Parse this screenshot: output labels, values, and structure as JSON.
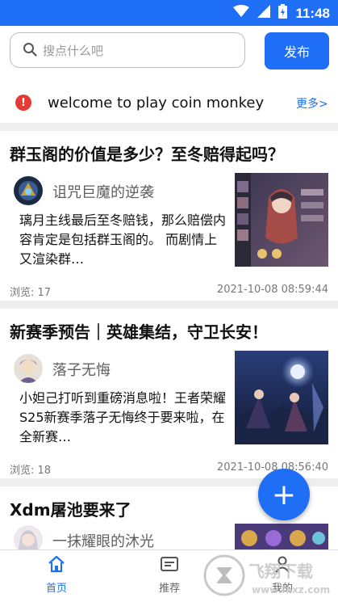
{
  "status": {
    "time": "11:48"
  },
  "search": {
    "placeholder": "搜点什么吧"
  },
  "header": {
    "publish_label": "发布"
  },
  "notice": {
    "text": "welcome to play coin monkey",
    "more_label": "更多>"
  },
  "posts": [
    {
      "title": "群玉阁的价值是多少？至冬赔得起吗？",
      "author": "诅咒巨魔的逆袭",
      "summary": "璃月主线最后至冬赔钱，那么赔偿内容肯定是包括群玉阁的。 而剧情上又渲染群…",
      "views": "浏览: 17",
      "time": "2021-10-08 08:59:44"
    },
    {
      "title": "新赛季预告｜英雄集结，守卫长安！",
      "author": "落子无悔",
      "summary": "小妲己打听到重磅消息啦！王者荣耀S25新赛季落子无悔终于要来啦，在全新赛…",
      "views": "浏览: 18",
      "time": "2021-10-08 08:56:40"
    },
    {
      "title": "Xdm屠池要来了",
      "author": "一抹耀眼的沐光"
    }
  ],
  "fab": {
    "label": "+"
  },
  "nav": {
    "items": [
      {
        "label": "首页"
      },
      {
        "label": "推荐"
      },
      {
        "label": "我的"
      }
    ]
  },
  "watermark": {
    "brand": "飞翔下载",
    "url": "www.fxxz.com"
  },
  "colors": {
    "accent": "#1e6ff5",
    "divider": "#eeeeee",
    "alert": "#e53935"
  }
}
